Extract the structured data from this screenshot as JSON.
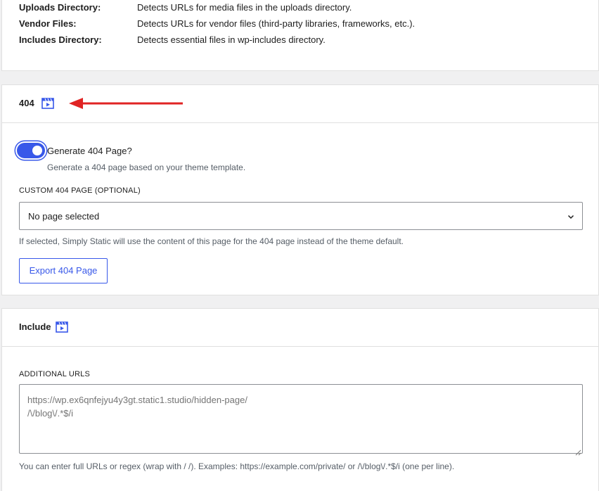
{
  "file_detection": {
    "rows": [
      {
        "label": "Uploads Directory:",
        "desc": "Detects URLs for media files in the uploads directory."
      },
      {
        "label": "Vendor Files:",
        "desc": "Detects URLs for vendor files (third-party libraries, frameworks, etc.)."
      },
      {
        "label": "Includes Directory:",
        "desc": "Detects essential files in wp-includes directory."
      }
    ]
  },
  "section_404": {
    "title": "404",
    "title_icon": "video-icon",
    "toggle": {
      "label": "Generate 404 Page?",
      "checked": true,
      "help": "Generate a 404 page based on your theme template."
    },
    "custom_page": {
      "label": "CUSTOM 404 PAGE (OPTIONAL)",
      "selected": "No page selected",
      "help": "If selected, Simply Static will use the content of this page for the 404 page instead of the theme default."
    },
    "export_button": "Export 404 Page"
  },
  "section_include": {
    "title": "Include",
    "title_icon": "video-icon",
    "additional_urls": {
      "label": "ADDITIONAL URLS",
      "lines": [
        "https://wp.ex6qnfejyu4y3gt.static1.studio/hidden-page/",
        "/\\/blog\\/.*$/i"
      ],
      "help": "You can enter full URLs or regex (wrap with / /). Examples: https://example.com/private/ or /\\/blog\\/.*$/i (one per line)."
    }
  },
  "colors": {
    "accent": "#3858e9",
    "annotation_arrow": "#e02424",
    "page_bg": "#f0f0f1"
  }
}
